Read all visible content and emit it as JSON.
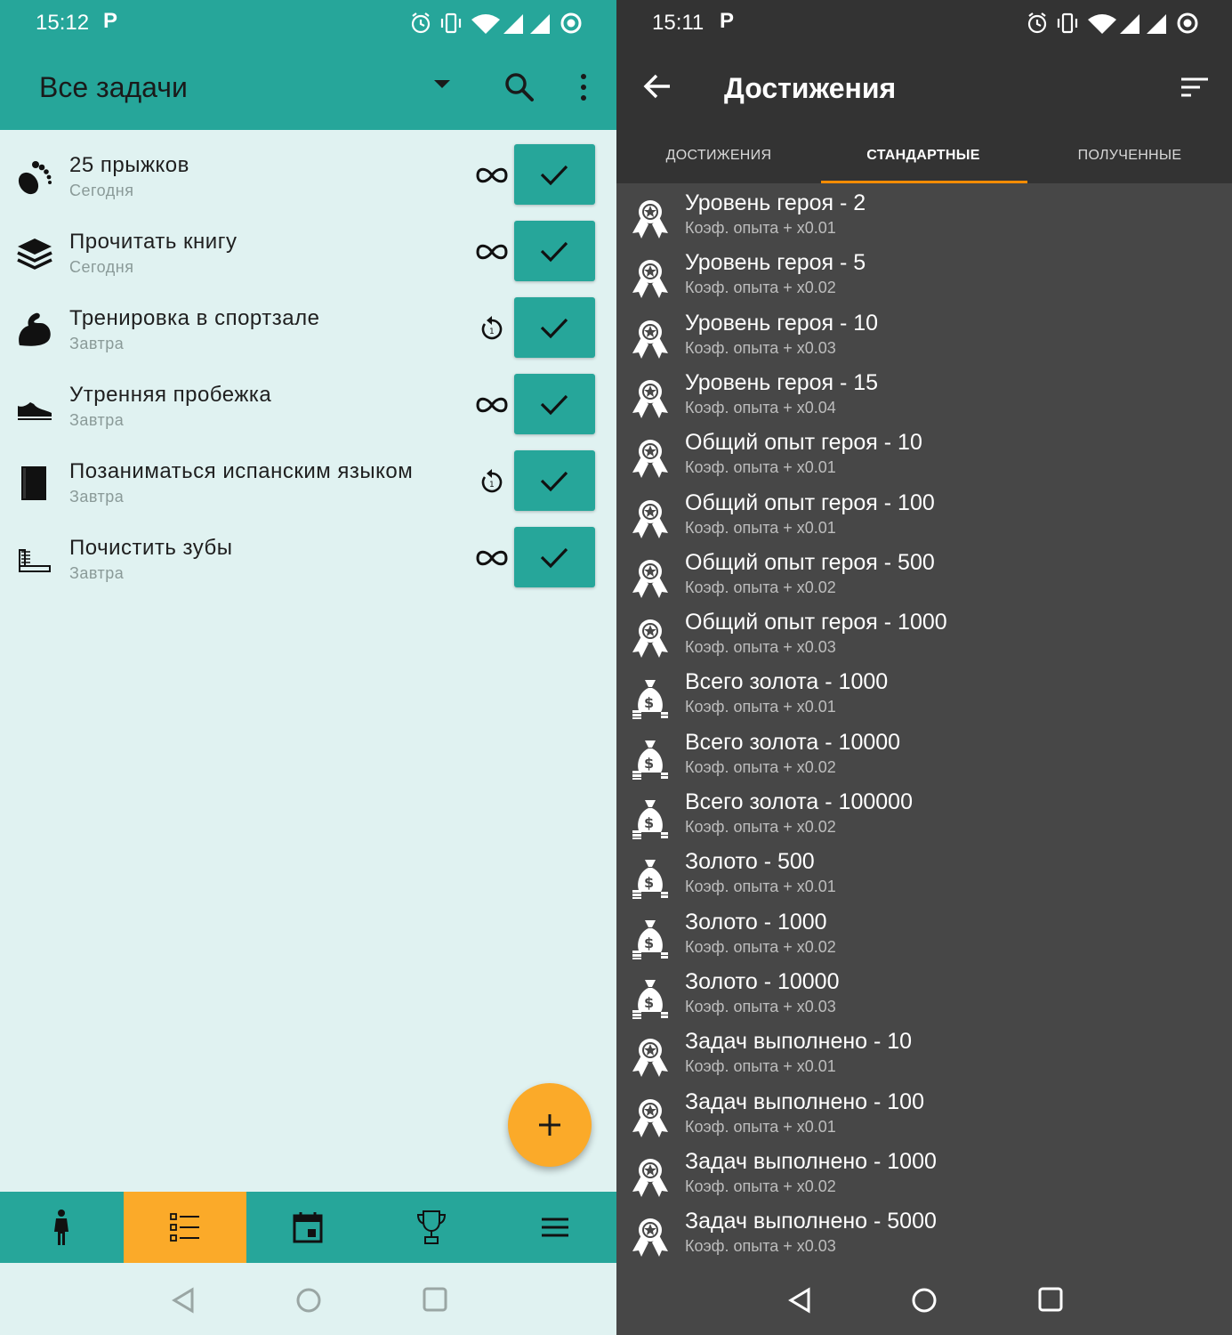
{
  "left": {
    "status": {
      "time": "15:12",
      "p_label": "P"
    },
    "appbar": {
      "title": "Все задачи"
    },
    "tasks": [
      {
        "name": "25 прыжков",
        "date": "Сегодня",
        "icon": "foot-icon",
        "repeat": "infinity"
      },
      {
        "name": "Прочитать книгу",
        "date": "Сегодня",
        "icon": "books-icon",
        "repeat": "infinity"
      },
      {
        "name": "Тренировка в спортзале",
        "date": "Завтра",
        "icon": "bicep-icon",
        "repeat": "once"
      },
      {
        "name": "Утренняя пробежка",
        "date": "Завтра",
        "icon": "sneaker-icon",
        "repeat": "infinity"
      },
      {
        "name": "Позаниматься испанским языком",
        "date": "Завтра",
        "icon": "book-icon",
        "repeat": "once"
      },
      {
        "name": "Почистить зубы",
        "date": "Завтра",
        "icon": "toothbrush-icon",
        "repeat": "infinity"
      }
    ],
    "bottom_nav": [
      "hero-icon",
      "tasks-icon",
      "calendar-icon",
      "trophy-icon",
      "menu-icon"
    ],
    "active_bottom": 1,
    "colors": {
      "primary": "#26a69a",
      "accent": "#fbaa29",
      "background": "#e0f2f1"
    }
  },
  "right": {
    "status": {
      "time": "15:11",
      "p_label": "P"
    },
    "appbar": {
      "title": "Достижения"
    },
    "tabs": [
      "ДОСТИЖЕНИЯ",
      "СТАНДАРТНЫЕ",
      "ПОЛУЧЕННЫЕ"
    ],
    "active_tab": 1,
    "achievements": [
      {
        "name": "Уровень героя - 2",
        "desc": "Коэф. опыта + x0.01",
        "icon": "ribbon-icon"
      },
      {
        "name": "Уровень героя - 5",
        "desc": "Коэф. опыта + x0.02",
        "icon": "ribbon-icon"
      },
      {
        "name": "Уровень героя - 10",
        "desc": "Коэф. опыта + x0.03",
        "icon": "ribbon-icon"
      },
      {
        "name": "Уровень героя - 15",
        "desc": "Коэф. опыта + x0.04",
        "icon": "ribbon-icon"
      },
      {
        "name": "Общий опыт героя - 10",
        "desc": "Коэф. опыта + x0.01",
        "icon": "ribbon-icon"
      },
      {
        "name": "Общий опыт героя - 100",
        "desc": "Коэф. опыта + x0.01",
        "icon": "ribbon-icon"
      },
      {
        "name": "Общий опыт героя - 500",
        "desc": "Коэф. опыта + x0.02",
        "icon": "ribbon-icon"
      },
      {
        "name": "Общий опыт героя - 1000",
        "desc": "Коэф. опыта + x0.03",
        "icon": "ribbon-icon"
      },
      {
        "name": "Всего золота - 1000",
        "desc": "Коэф. опыта + x0.01",
        "icon": "money-bag-icon"
      },
      {
        "name": "Всего золота - 10000",
        "desc": "Коэф. опыта + x0.02",
        "icon": "money-bag-icon"
      },
      {
        "name": "Всего золота - 100000",
        "desc": "Коэф. опыта + x0.02",
        "icon": "money-bag-icon"
      },
      {
        "name": "Золото - 500",
        "desc": "Коэф. опыта + x0.01",
        "icon": "money-bag-icon"
      },
      {
        "name": "Золото - 1000",
        "desc": "Коэф. опыта + x0.02",
        "icon": "money-bag-icon"
      },
      {
        "name": "Золото - 10000",
        "desc": "Коэф. опыта + x0.03",
        "icon": "money-bag-icon"
      },
      {
        "name": "Задач выполнено - 10",
        "desc": "Коэф. опыта + x0.01",
        "icon": "ribbon-icon"
      },
      {
        "name": "Задач выполнено - 100",
        "desc": "Коэф. опыта + x0.01",
        "icon": "ribbon-icon"
      },
      {
        "name": "Задач выполнено - 1000",
        "desc": "Коэф. опыта + x0.02",
        "icon": "ribbon-icon"
      },
      {
        "name": "Задач выполнено - 5000",
        "desc": "Коэф. опыта + x0.03",
        "icon": "ribbon-icon"
      }
    ],
    "colors": {
      "bar": "#333333",
      "background": "#474747",
      "tab_indicator": "#fb8c00"
    }
  }
}
